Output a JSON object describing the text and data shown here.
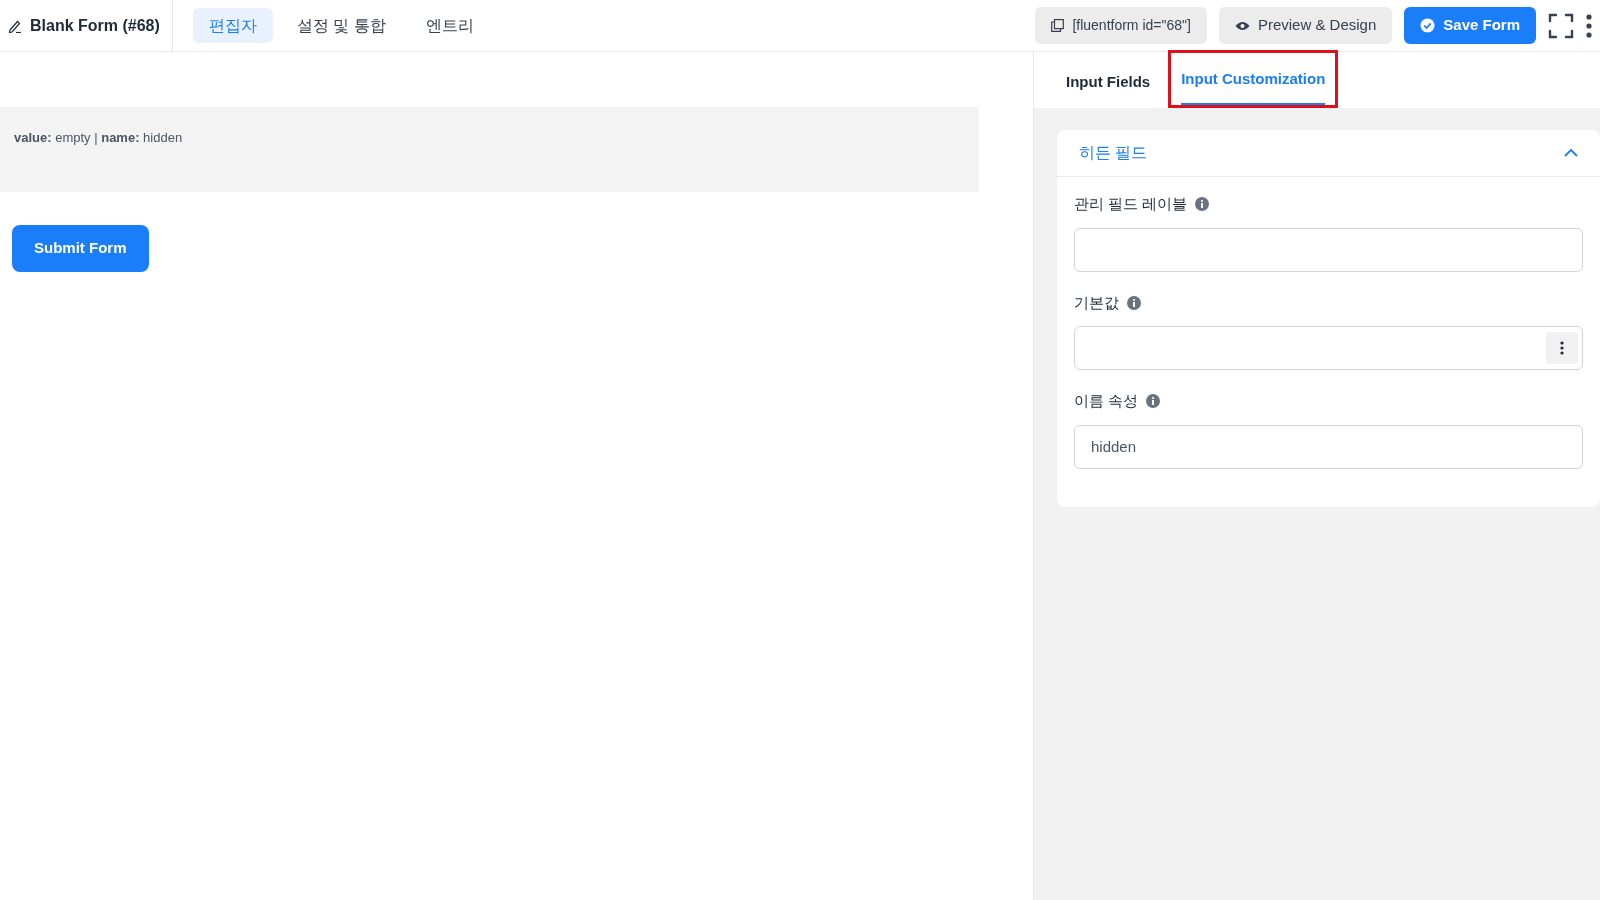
{
  "header": {
    "title": "Blank Form (#68)",
    "tabs": [
      {
        "label": "편집자",
        "selected": true
      },
      {
        "label": "설정 및 통합",
        "selected": false
      },
      {
        "label": "엔트리",
        "selected": false
      }
    ],
    "shortcode": "[fluentform id=\"68\"]",
    "preview_button": "Preview & Design",
    "save_button": "Save Form"
  },
  "form_preview": {
    "hidden_field_info": "**value:** empty | **name:** hidden",
    "submit_button": "Submit Form"
  },
  "sidebar": {
    "tabs": [
      {
        "label": "Input Fields",
        "selected": false,
        "highlighted": false
      },
      {
        "label": "Input Customization",
        "selected": true,
        "highlighted": true
      }
    ],
    "section": {
      "title": "히든 필드",
      "expanded": true,
      "fields": [
        {
          "kind": "text",
          "label": "관리 필드 레이블"
        },
        {
          "kind": "text_with_menu",
          "label": "기본값"
        },
        {
          "kind": "text",
          "label": "이름 속성",
          "value": "hidden"
        }
      ]
    }
  }
}
